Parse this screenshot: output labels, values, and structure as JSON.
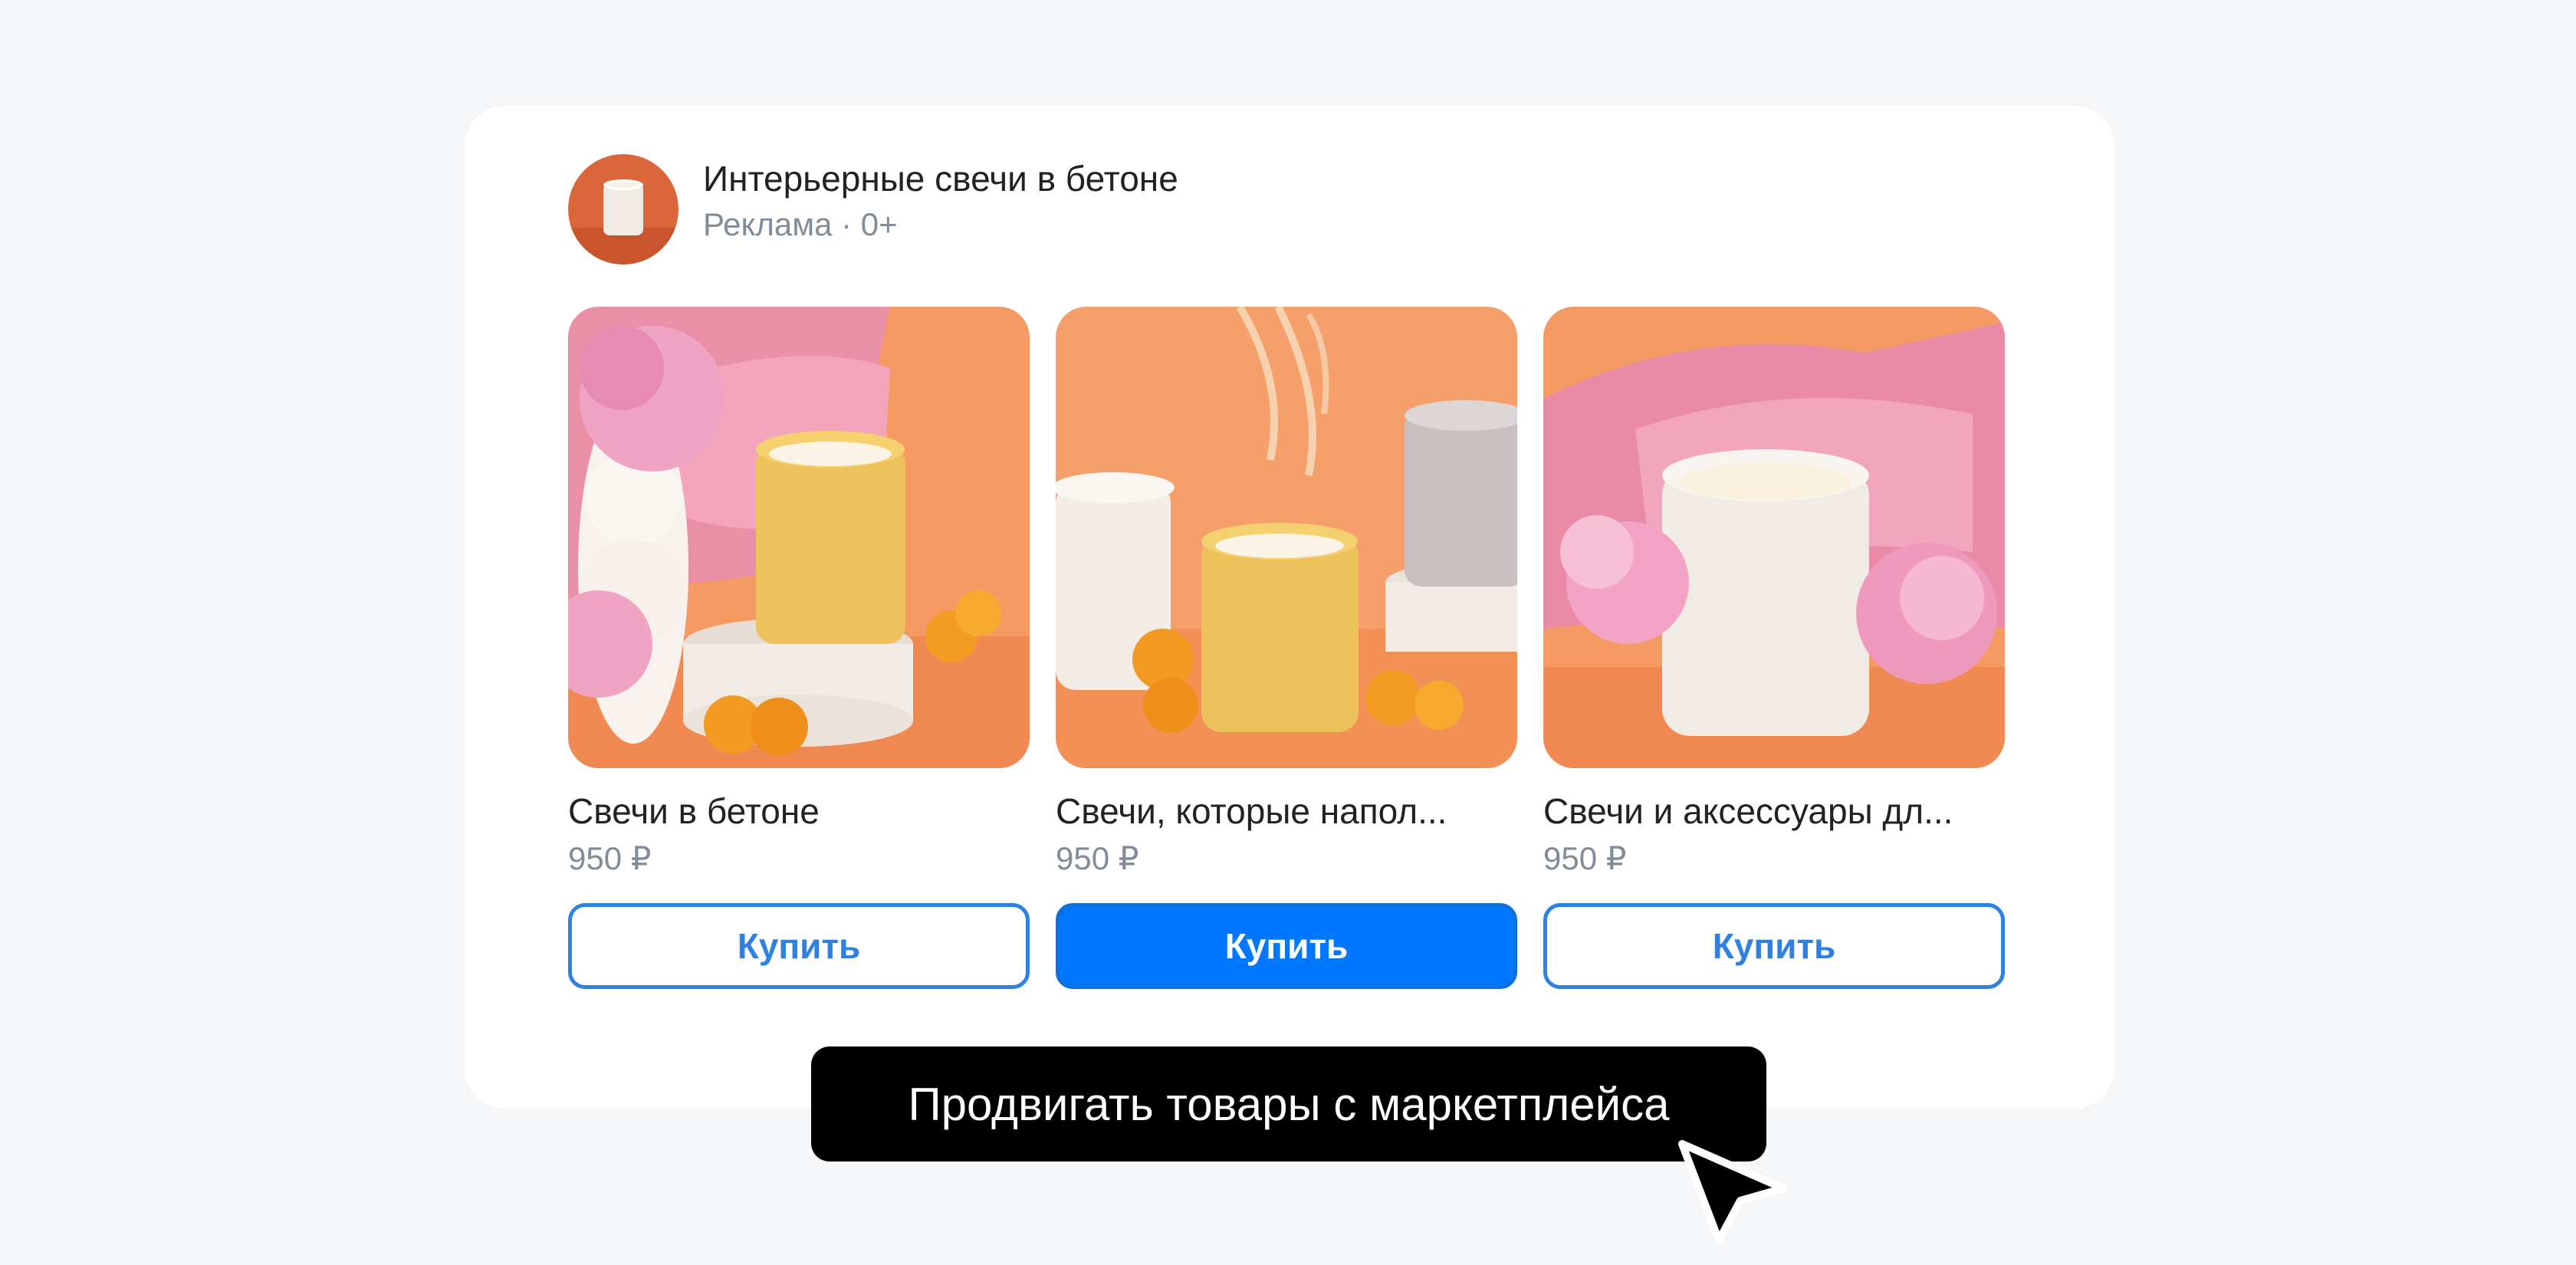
{
  "ad": {
    "title": "Интерьерные свечи в бетоне",
    "subtitle": "Реклама · 0+"
  },
  "products": [
    {
      "name": "Свечи в бетоне",
      "price": "950 ₽",
      "button": "Купить"
    },
    {
      "name": "Свечи, которые напол...",
      "price": "950 ₽",
      "button": "Купить"
    },
    {
      "name": "Свечи и аксессуары дл...",
      "price": "950 ₽",
      "button": "Купить"
    }
  ],
  "tooltip": "Продвигать товары с маркетплейса",
  "colors": {
    "accent": "#0077ff",
    "outline_button": "#2d81e0",
    "tooltip_bg": "#000000",
    "photo_background": "#f39a63"
  },
  "icons": {
    "cursor": "mouse-pointer-icon"
  }
}
